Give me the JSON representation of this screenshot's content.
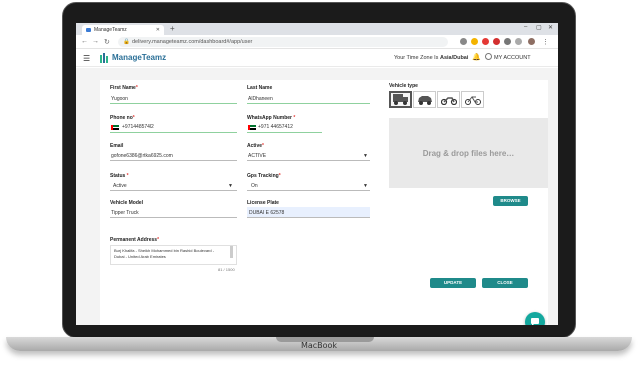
{
  "device": {
    "brand": "MacBook"
  },
  "browser": {
    "tab_title": "ManageTeamz",
    "new_tab": "+",
    "url": "delivery.manageteamz.com/dashboard#/app/user"
  },
  "header": {
    "logo": "ManageTeamz",
    "timezone_label": "Your Time Zone Is ",
    "timezone_value": "Asia/Dubai",
    "account": "MY ACCOUNT"
  },
  "form": {
    "first_name": {
      "label": "First Name",
      "value": "Yugoon"
    },
    "last_name": {
      "label": "Last Name",
      "value": "AlDhaneen"
    },
    "phone": {
      "label": "Phone no",
      "value": "+971448574l2"
    },
    "whatsapp": {
      "label": "WhatsApp Number",
      "value": "44657412"
    },
    "email": {
      "label": "Email",
      "value": "gofone6386@rtka6925.com"
    },
    "active": {
      "label": "Active",
      "value": "ACTIVE"
    },
    "status": {
      "label": "Status",
      "value": "Active"
    },
    "gps": {
      "label": "Gps Tracking",
      "value": "On"
    },
    "vehicle_model": {
      "label": "Vehicle Model",
      "value": "Tipper Truck"
    },
    "license_plate": {
      "label": "License Plate",
      "value": "DUBAI E 62578"
    },
    "address": {
      "label": "Permanent Address",
      "line1": "Burj Khalifa - Sheikh Mohammed bin Rashid Boulevard -",
      "line2": "Dubai - United Arab Emirates",
      "counter": "81 / 1500"
    },
    "required_mark": "*"
  },
  "vehicle": {
    "label": "Vehicle type",
    "types": [
      "truck-icon",
      "car-icon",
      "motorcycle-icon",
      "bicycle-icon"
    ],
    "selected": "truck-icon",
    "drop_text": "Drag & drop files here…",
    "browse": "BROWSE"
  },
  "actions": {
    "update": "UPDATE",
    "close": "CLOSE"
  },
  "colors": {
    "accent": "#1f8a8a",
    "brand": "#2a6f97",
    "chat": "#13a89e"
  }
}
